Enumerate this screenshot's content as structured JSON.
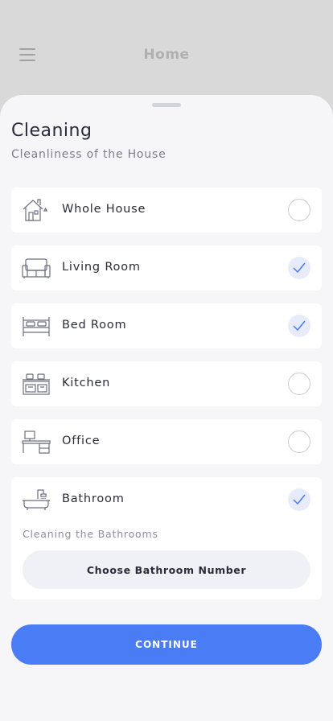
{
  "header": {
    "title": "Home",
    "menu_icon": "hamburger-menu-icon"
  },
  "sheet": {
    "title": "Cleaning",
    "subtitle": "Cleanliness of the House",
    "rooms": [
      {
        "label": "Whole House",
        "icon": "house-icon",
        "checked": false
      },
      {
        "label": "Living Room",
        "icon": "sofa-icon",
        "checked": true
      },
      {
        "label": "Bed Room",
        "icon": "bed-icon",
        "checked": true
      },
      {
        "label": "Kitchen",
        "icon": "stove-icon",
        "checked": false
      },
      {
        "label": "Office",
        "icon": "desk-icon",
        "checked": false
      },
      {
        "label": "Bathroom",
        "icon": "bathtub-icon",
        "checked": true,
        "note": "Cleaning the Bathrooms",
        "button_label": "Choose Bathroom Number"
      }
    ]
  },
  "footer": {
    "continue_label": "CONTINUE"
  },
  "colors": {
    "accent": "#4a7cf6",
    "check_bg": "#e8ebf9",
    "check_mark": "#4a7cf6"
  }
}
